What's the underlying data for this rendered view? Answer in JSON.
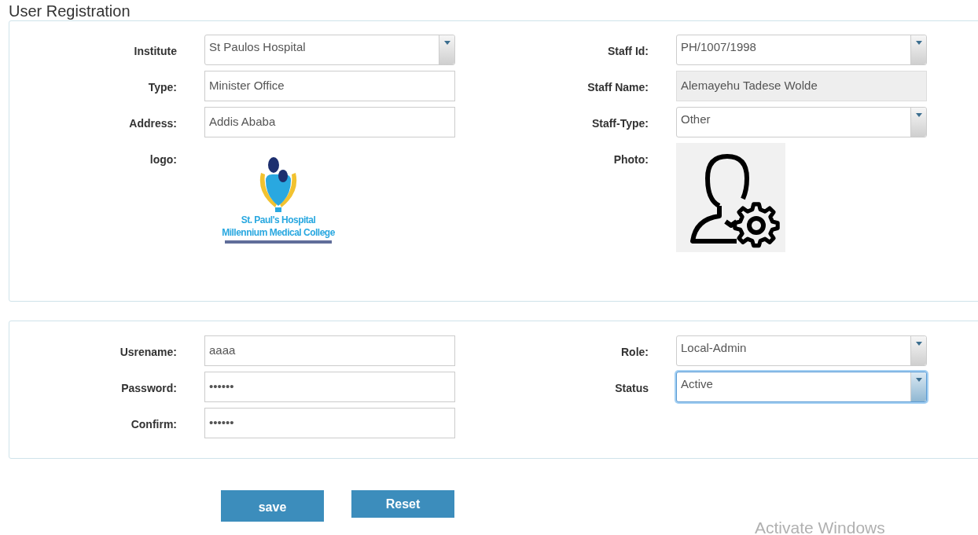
{
  "title": "User Registration",
  "sections": [
    {
      "left": [
        {
          "label": "Institute",
          "kind": "select",
          "value": "St Paulos Hospital",
          "disabled": false
        },
        {
          "label": "Type:",
          "kind": "text",
          "value": "Minister Office",
          "disabled": false
        },
        {
          "label": "Address:",
          "kind": "text",
          "value": "Addis Ababa",
          "disabled": false
        },
        {
          "label": "logo:",
          "kind": "logo",
          "logo_text": [
            "St. Paul's Hospital",
            "Millennium Medical College"
          ]
        }
      ],
      "right": [
        {
          "label": "Staff Id:",
          "kind": "select",
          "value": "PH/1007/1998",
          "disabled": false
        },
        {
          "label": "Staff Name:",
          "kind": "text",
          "value": "Alemayehu Tadese Wolde",
          "disabled": true
        },
        {
          "label": "Staff-Type:",
          "kind": "select",
          "value": "Other",
          "disabled": false
        },
        {
          "label": "Photo:"
        }
      ]
    },
    {
      "left": [
        {
          "label": "Usrename:",
          "kind": "text",
          "value": "aaaa",
          "focused": false
        },
        {
          "label": "Password:",
          "kind": "text",
          "value": "••••••",
          "focused": false
        },
        {
          "label": "Confirm:",
          "kind": "text",
          "value": "••••••",
          "focused": false
        }
      ],
      "right": [
        {
          "label": "Role:",
          "kind": "select",
          "value": "Local-Admin",
          "focused": false
        },
        {
          "label": "Status",
          "kind": "select",
          "value": "Active",
          "focused": true
        }
      ]
    }
  ],
  "buttons": [
    "save",
    "Reset"
  ],
  "watermark": [
    "Activate Windows"
  ]
}
